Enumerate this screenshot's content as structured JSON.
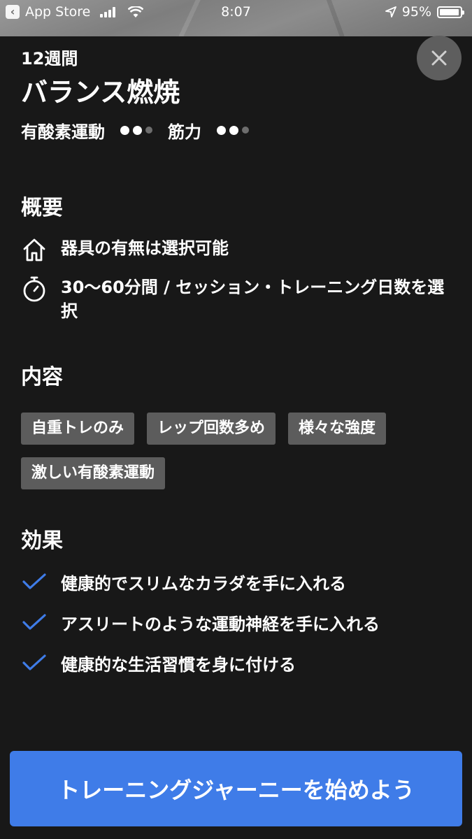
{
  "status_bar": {
    "back_app": "App Store",
    "time": "8:07",
    "battery": "95%"
  },
  "plan": {
    "duration": "12週間",
    "title": "バランス燃焼",
    "cardio_label": "有酸素運動",
    "cardio_level": 2,
    "strength_label": "筋力",
    "strength_level": 2,
    "level_max": 3
  },
  "overview": {
    "title": "概要",
    "equipment": "器具の有無は選択可能",
    "session": "30〜60分間 / セッション・トレーニング日数を選択"
  },
  "content": {
    "title": "内容",
    "tags": [
      "自重トレのみ",
      "レップ回数多め",
      "様々な強度",
      "激しい有酸素運動"
    ]
  },
  "effects": {
    "title": "効果",
    "items": [
      "健康的でスリムなカラダを手に入れる",
      "アスリートのような運動神経を手に入れる",
      "健康的な生活習慣を身に付ける"
    ]
  },
  "cta": {
    "label": "トレーニングジャーニーを始めよう"
  },
  "colors": {
    "background": "#181818",
    "accent": "#3f7ce8",
    "tag_bg": "#5c5c5c",
    "check": "#3f7ce8"
  }
}
